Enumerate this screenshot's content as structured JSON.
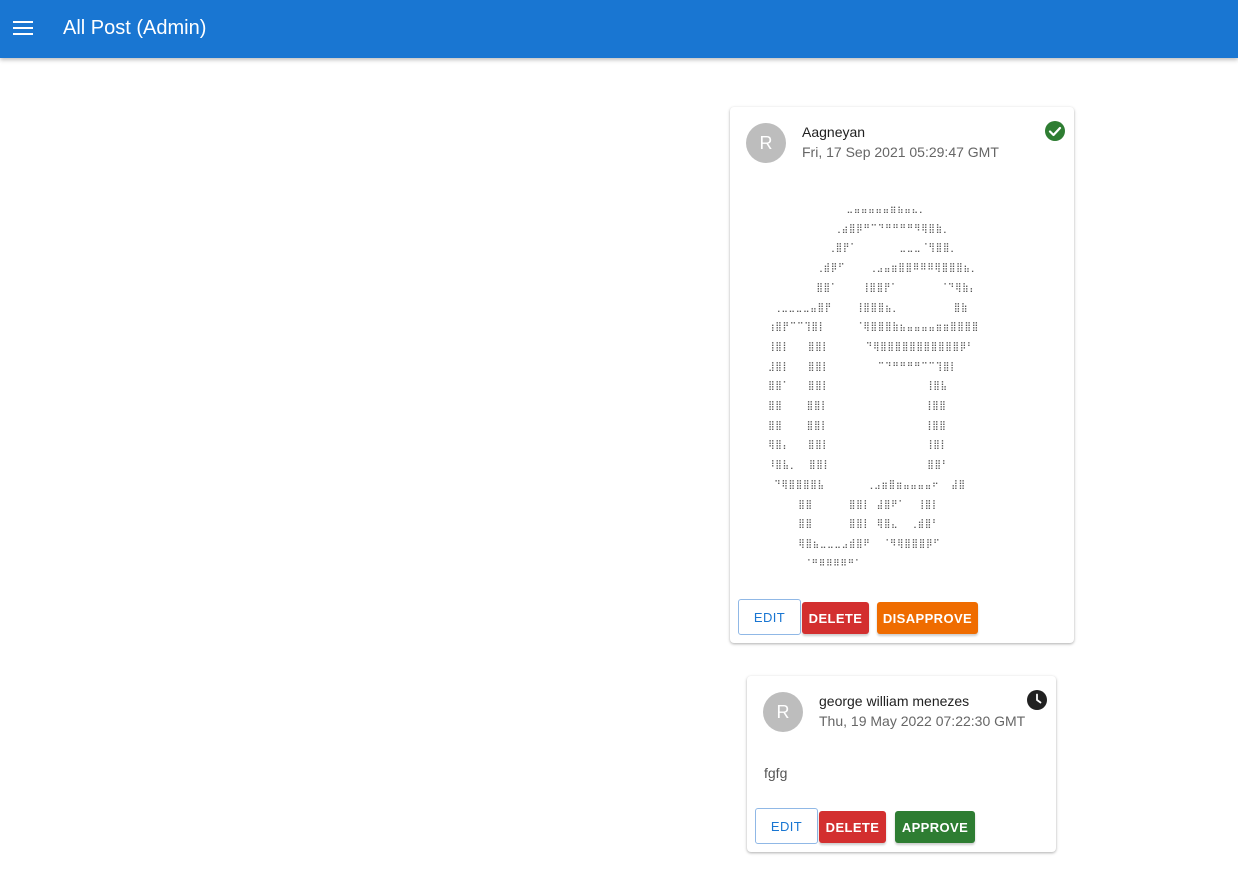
{
  "appbar": {
    "menu_icon": "menu-icon",
    "title": "All Post (Admin)",
    "color": "#1976d2"
  },
  "posts": [
    {
      "avatar_letter": "R",
      "author": "Aagneyan",
      "date": "Fri, 17 Sep 2021 05:29:47 GMT",
      "status_icon": "check-circle-icon",
      "status_color": "#2e7d32",
      "content_image": "ascii-art-logo",
      "buttons": {
        "edit": "EDIT",
        "delete": "DELETE",
        "toggle": "DISAPPROVE"
      }
    },
    {
      "avatar_letter": "R",
      "author": "george william menezes",
      "date": "Thu, 19 May 2022 07:22:30 GMT",
      "status_icon": "clock-icon",
      "status_color": "#212121",
      "text": "fgfg",
      "buttons": {
        "edit": "EDIT",
        "delete": "DELETE",
        "toggle": "APPROVE"
      }
    }
  ]
}
